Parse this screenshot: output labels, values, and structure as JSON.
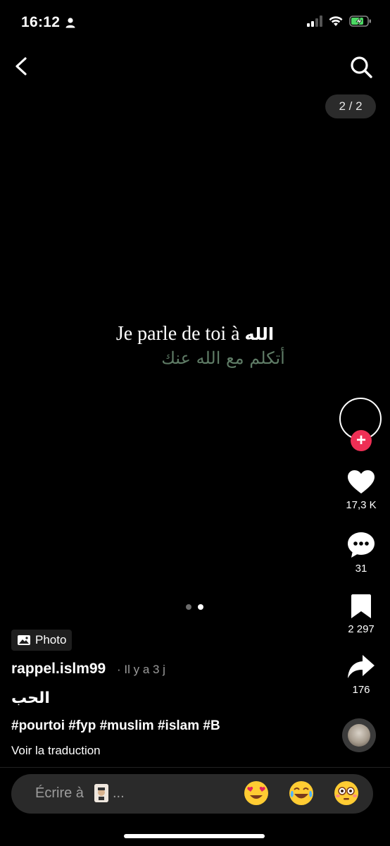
{
  "status_bar": {
    "time": "16:12",
    "battery_charging": true
  },
  "nav": {
    "counter": "2 / 2"
  },
  "media": {
    "line1_fr": "Je parle de toi à ",
    "line1_ar": "الله",
    "line2_ar": "أتكلم مع الله عنك"
  },
  "actions": {
    "likes": "17,3 K",
    "comments": "31",
    "saves": "2 297",
    "shares": "176"
  },
  "pager": {
    "count": 2,
    "active": 1
  },
  "post": {
    "tag": "Photo",
    "username": "rappel.islm99",
    "timeago": "· Il y a 3 j",
    "caption": "الحب",
    "hashtags": "#pourtoi #fyp #muslim #islam #B",
    "translate": "Voir la traduction"
  },
  "comment_box": {
    "placeholder": "Écrire à",
    "suffix": "..."
  },
  "colors": {
    "follow": "#ee2f55",
    "arabic_line": "#5f7c66",
    "background": "#000000"
  }
}
